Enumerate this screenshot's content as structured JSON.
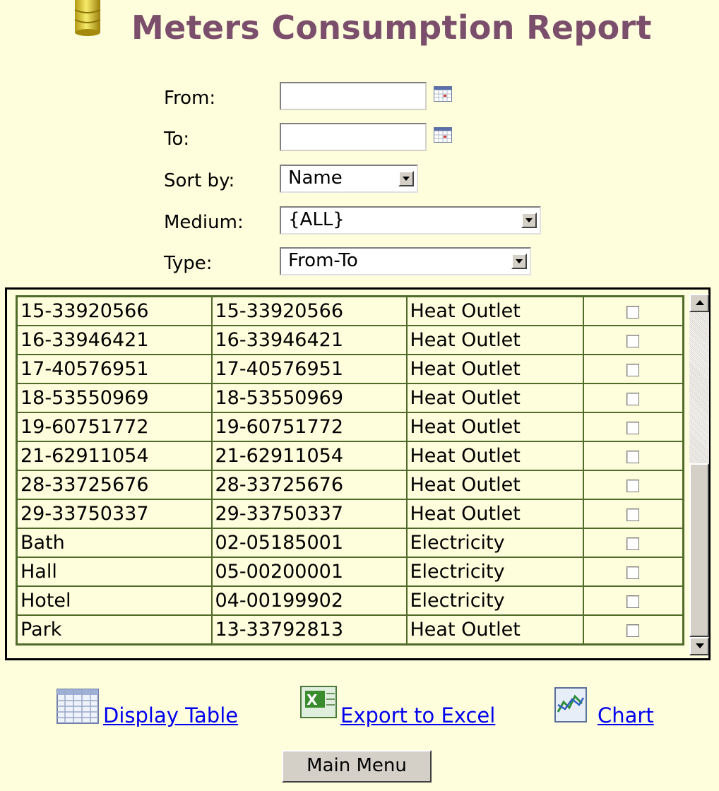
{
  "header": {
    "title": "Meters Consumption Report",
    "icon": "database-icon"
  },
  "form": {
    "from_label": "From:",
    "from_value": "",
    "to_label": "To:",
    "to_value": "",
    "sortby_label": "Sort by:",
    "sortby_value": "Name",
    "medium_label": "Medium:",
    "medium_value": "{ALL}",
    "type_label": "Type:",
    "type_value": "From-To"
  },
  "grid": {
    "rows": [
      [
        "15-33920566",
        "15-33920566",
        "Heat Outlet"
      ],
      [
        "16-33946421",
        "16-33946421",
        "Heat Outlet"
      ],
      [
        "17-40576951",
        "17-40576951",
        "Heat Outlet"
      ],
      [
        "18-53550969",
        "18-53550969",
        "Heat Outlet"
      ],
      [
        "19-60751772",
        "19-60751772",
        "Heat Outlet"
      ],
      [
        "21-62911054",
        "21-62911054",
        "Heat Outlet"
      ],
      [
        "28-33725676",
        "28-33725676",
        "Heat Outlet"
      ],
      [
        "29-33750337",
        "29-33750337",
        "Heat Outlet"
      ],
      [
        "Bath",
        "02-05185001",
        "Electricity"
      ],
      [
        "Hall",
        "05-00200001",
        "Electricity"
      ],
      [
        "Hotel",
        "04-00199902",
        "Electricity"
      ],
      [
        "Park",
        "13-33792813",
        "Heat Outlet"
      ]
    ]
  },
  "actions": {
    "display_table": "Display Table",
    "export_excel": "Export to Excel",
    "chart": "Chart"
  },
  "main_menu": "Main Menu",
  "colors": {
    "background": "#fefedc",
    "title": "#7b4e6c",
    "grid_border": "#4f6a2a",
    "link": "#0000ee"
  }
}
